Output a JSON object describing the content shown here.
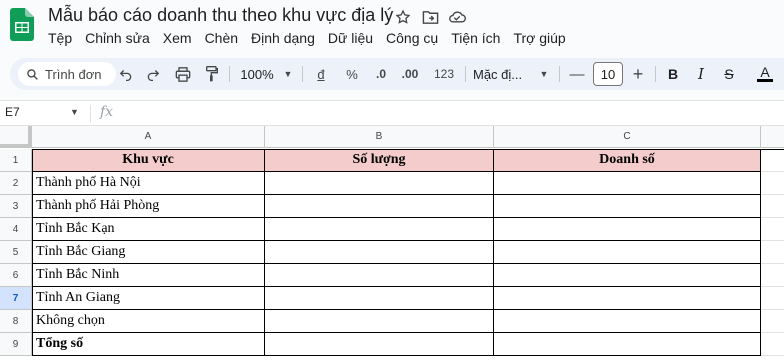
{
  "app": {
    "title": "Mẫu báo cáo doanh thu theo khu vực địa lý",
    "menu": [
      "Tệp",
      "Chỉnh sửa",
      "Xem",
      "Chèn",
      "Định dạng",
      "Dữ liệu",
      "Công cụ",
      "Tiện ích",
      "Trợ giúp"
    ]
  },
  "toolbar": {
    "search_label": "Trình đơn",
    "zoom": "100%",
    "currency": "đ",
    "percent": "%",
    "dec_decrease": ".0",
    "dec_increase": ".00",
    "number_format": "123",
    "font": "Mặc đị...",
    "font_size": "10",
    "minus": "—",
    "plus": "+",
    "bold": "B",
    "italic": "I",
    "strike": "S",
    "text_color": "A"
  },
  "formula_bar": {
    "name_box": "E7",
    "fx": "fx"
  },
  "sheet": {
    "columns": [
      "A",
      "B",
      "C"
    ],
    "row_numbers": [
      "1",
      "2",
      "3",
      "4",
      "5",
      "6",
      "7",
      "8",
      "9"
    ],
    "active_row": "7",
    "header_row": [
      "Khu vực",
      "Số lượng",
      "Doanh  số"
    ],
    "rows": [
      [
        "Thành phố Hà Nội",
        "",
        ""
      ],
      [
        "Thành phố Hải Phòng",
        "",
        ""
      ],
      [
        "Tỉnh Bắc Kạn",
        "",
        ""
      ],
      [
        "Tỉnh Bắc Giang",
        "",
        ""
      ],
      [
        "Tỉnh Bắc Ninh",
        "",
        ""
      ],
      [
        "Tỉnh An Giang",
        "",
        ""
      ],
      [
        "Không chọn",
        "",
        ""
      ],
      [
        "Tổng số",
        "",
        ""
      ]
    ]
  },
  "colors": {
    "header_fill": "#f4cccc",
    "accent": "#0b57d0",
    "logo_green": "#0f9d58"
  }
}
